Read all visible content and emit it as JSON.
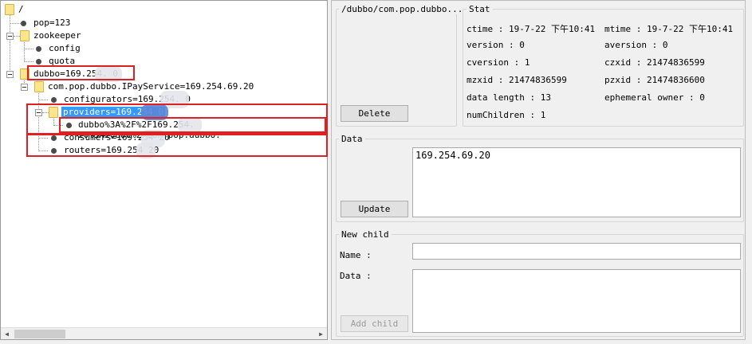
{
  "tree": {
    "nodes": [
      {
        "label": "/"
      },
      {
        "label": "pop=123"
      },
      {
        "label": "zookeeper"
      },
      {
        "label": "config"
      },
      {
        "label": "quota"
      },
      {
        "label": "dubbo=169.254.   0"
      },
      {
        "label": "com.pop.dubbo.IPayService=169.254.69.20"
      },
      {
        "label": "configurators=169.254.   0"
      },
      {
        "label": "providers=169.254   0"
      },
      {
        "label": "dubbo%3A%2F%2F169.254.   20%3A20880%2Fcom.pop.dubbo."
      },
      {
        "label": "consumers=169.254   20"
      },
      {
        "label": "routers=169.254   20"
      }
    ]
  },
  "detail": {
    "path": "/dubbo/com.pop.dubbo...",
    "delete_label": "Delete",
    "stat": {
      "title": "Stat",
      "ctime": "ctime : 19-7-22 下午10:41",
      "mtime": "mtime : 19-7-22 下午10:41",
      "version": "version : 0",
      "aversion": "aversion : 0",
      "cversion": "cversion : 1",
      "czxid": "czxid : 21474836599",
      "mzxid": "mzxid : 21474836599",
      "pzxid": "pzxid : 21474836600",
      "data_length": "data length : 13",
      "ephemeral_owner": "ephemeral owner : 0",
      "num_children": "numChildren : 1"
    },
    "data_section": {
      "title": "Data",
      "value": "169.254.69.20",
      "update_label": "Update"
    },
    "new_child": {
      "title": "New child",
      "name_label": "Name :",
      "name_value": "",
      "data_label": "Data :",
      "data_value": "",
      "add_label": "Add child"
    }
  },
  "colors": {
    "selection": "#3399ff",
    "highlight_box": "#e02020",
    "folder": "#fde58e"
  }
}
